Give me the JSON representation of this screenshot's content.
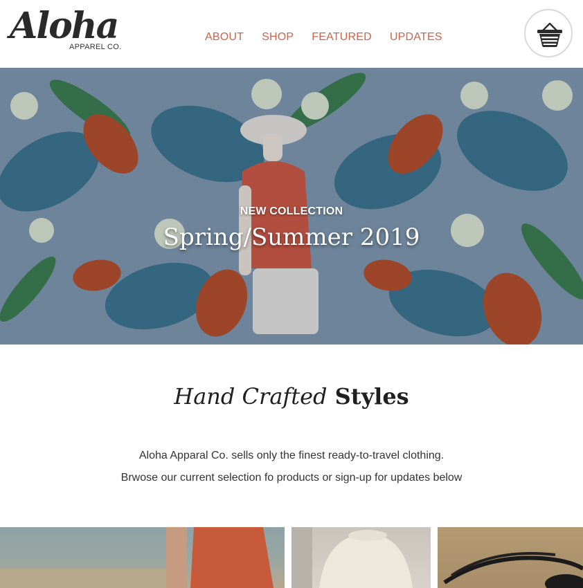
{
  "brand": {
    "logo_script": "Aloha",
    "logo_sub": "APPAREL CO."
  },
  "nav": {
    "items": [
      {
        "label": "ABOUT"
      },
      {
        "label": "SHOP"
      },
      {
        "label": "FEATURED"
      },
      {
        "label": "UPDATES"
      }
    ],
    "color": "#c8654c"
  },
  "cart": {
    "icon": "shopping-basket-icon"
  },
  "hero": {
    "kicker": "NEW COLLECTION",
    "title": "Spring/Summer 2019"
  },
  "intro": {
    "heading_italic": "Hand Crafted",
    "heading_bold": "Styles",
    "line1": "Aloha Apparal Co. sells only the finest ready-to-travel clothing.",
    "line2": "Brwose our current selection fo products or sign-up for updates below"
  },
  "products": [
    {
      "name": "product-tile-shorts"
    },
    {
      "name": "product-tile-hat"
    },
    {
      "name": "product-tile-sunglasses"
    }
  ]
}
